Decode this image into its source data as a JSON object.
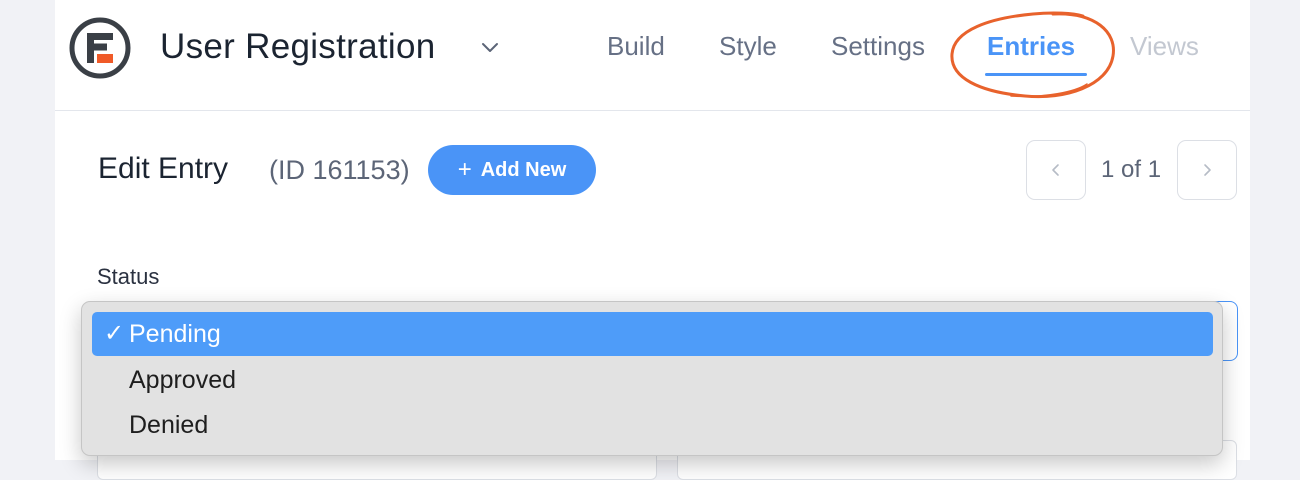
{
  "header": {
    "app_title": "User Registration",
    "nav_tabs": [
      {
        "label": "Build",
        "state": "normal"
      },
      {
        "label": "Style",
        "state": "normal"
      },
      {
        "label": "Settings",
        "state": "normal"
      },
      {
        "label": "Entries",
        "state": "active"
      },
      {
        "label": "Views",
        "state": "disabled"
      }
    ]
  },
  "entry": {
    "title": "Edit Entry",
    "id_text": "(ID 161153)",
    "add_new_label": "Add New"
  },
  "pagination": {
    "text": "1 of 1"
  },
  "status": {
    "label": "Status",
    "options": [
      {
        "label": "Pending",
        "selected": true
      },
      {
        "label": "Approved",
        "selected": false
      },
      {
        "label": "Denied",
        "selected": false
      }
    ],
    "selected_check": "✓"
  },
  "icons": {
    "logo": "formidable-logo-icon",
    "title_dropdown": "chevron-down-icon",
    "prev": "chevron-left-icon",
    "next": "chevron-right-icon",
    "add": "plus-icon",
    "check": "checkmark-icon"
  },
  "colors": {
    "accent": "#4a94f7",
    "selected_option": "#4e9cf9",
    "annotation": "#e8622c",
    "logo_dark": "#3a3f46",
    "logo_orange": "#f05a28"
  }
}
